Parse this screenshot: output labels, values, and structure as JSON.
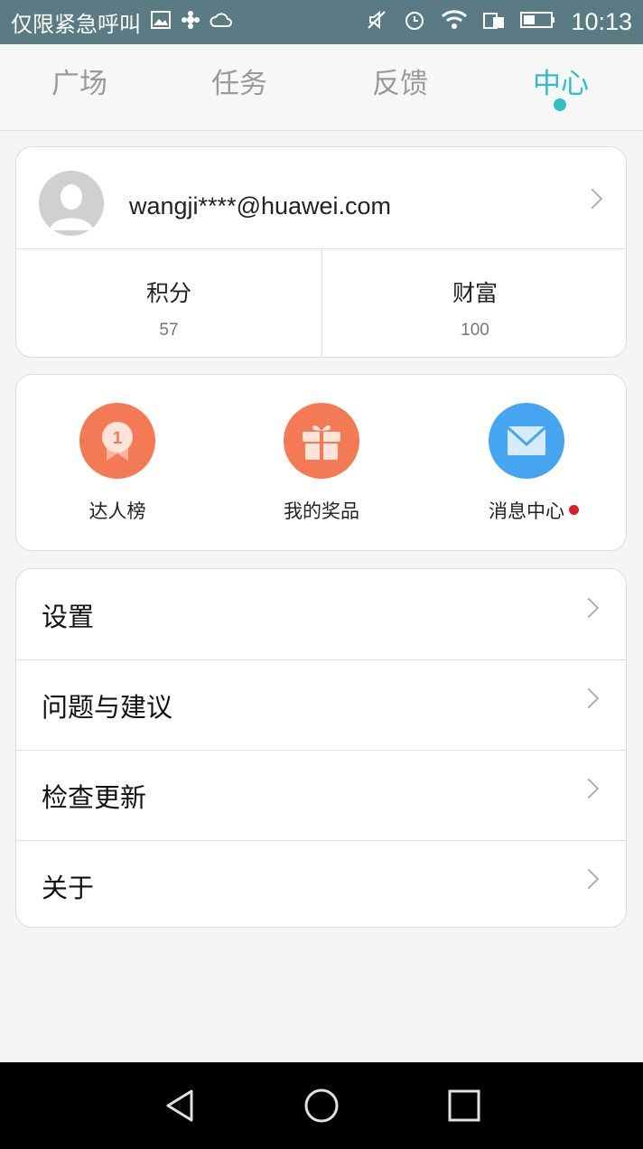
{
  "status_bar": {
    "carrier_text": "仅限紧急呼叫",
    "time": "10:13"
  },
  "tabs": [
    {
      "label": "广场",
      "active": false
    },
    {
      "label": "任务",
      "active": false
    },
    {
      "label": "反馈",
      "active": false
    },
    {
      "label": "中心",
      "active": true
    }
  ],
  "profile": {
    "email": "wangji****@huawei.com",
    "stats": [
      {
        "label": "积分",
        "value": "57"
      },
      {
        "label": "财富",
        "value": "100"
      }
    ]
  },
  "shortcuts": [
    {
      "label": "达人榜",
      "icon": "badge-icon",
      "color": "#f37a55"
    },
    {
      "label": "我的奖品",
      "icon": "gift-icon",
      "color": "#f37a55"
    },
    {
      "label": "消息中心",
      "icon": "mail-icon",
      "color": "#45a5f0",
      "has_notification": true
    }
  ],
  "badge_number": "1",
  "menu": [
    {
      "label": "设置"
    },
    {
      "label": "问题与建议"
    },
    {
      "label": "检查更新"
    },
    {
      "label": "关于"
    }
  ],
  "colors": {
    "accent": "#2ec0c4",
    "status_bar": "#5b7b84"
  }
}
